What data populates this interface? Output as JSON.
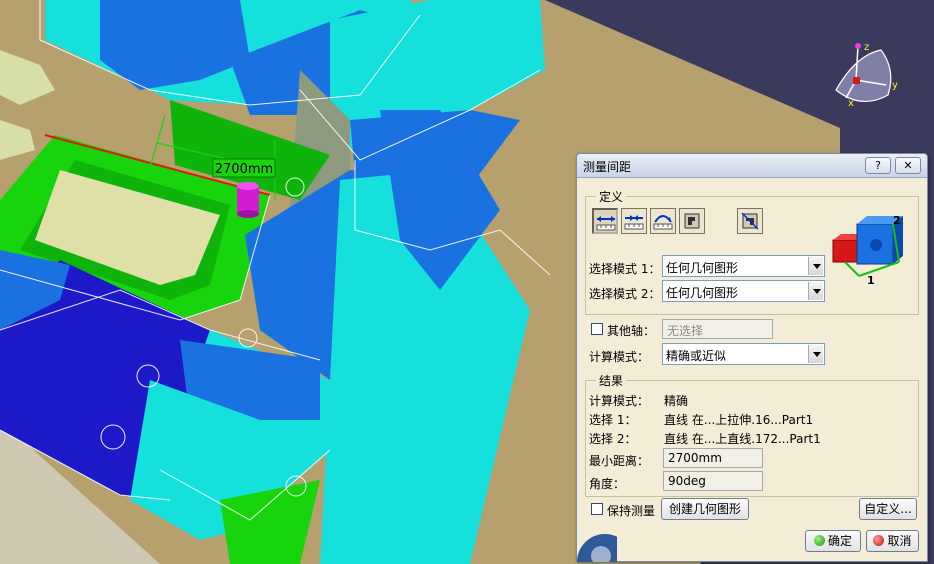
{
  "viewport": {
    "measure_label": "2700mm",
    "compass": {
      "axis_x": "x",
      "axis_y": "y",
      "axis_z": "z"
    },
    "colors": {
      "background": "#3c3a5c",
      "floor": "#b5a06e",
      "cyan": "#16e0dc",
      "blue": "#1a72e0",
      "green": "#17d40d",
      "dark_blue": "#1d18c8"
    }
  },
  "dialog": {
    "title": "测量间距",
    "help_label": "?",
    "close_label": "✕",
    "definition": {
      "legend": "定义",
      "tools": [
        {
          "name": "measure-between-icon"
        },
        {
          "name": "measure-chain-icon"
        },
        {
          "name": "measure-fan-icon"
        },
        {
          "name": "measure-item-icon"
        },
        {
          "name": "measure-thickness-icon"
        }
      ],
      "mode1_label": "选择模式 1：",
      "mode1_value": "任何几何图形",
      "mode2_label": "选择模式 2：",
      "mode2_value": "任何几何图形",
      "preview_label_1": "1",
      "preview_label_2": "2"
    },
    "other_axis_label": "其他轴：",
    "other_axis_value": "无选择",
    "calc_mode_label": "计算模式：",
    "calc_mode_value": "精确或近似",
    "results": {
      "legend": "结果",
      "calc_mode_label": "计算模式：",
      "calc_mode_value": "精确",
      "sel1_label": "选择 1：",
      "sel1_value": "直线 在...上拉伸.16...Part1",
      "sel2_label": "选择 2：",
      "sel2_value": "直线 在...上直线.172...Part1",
      "min_dist_label": "最小距离：",
      "min_dist_value": "2700mm",
      "angle_label": "角度：",
      "angle_value": "90deg"
    },
    "keep_measure_label": "保持测量",
    "create_geometry_label": "创建几何图形",
    "customize_label": "自定义...",
    "ok_label": "确定",
    "cancel_label": "取消"
  }
}
